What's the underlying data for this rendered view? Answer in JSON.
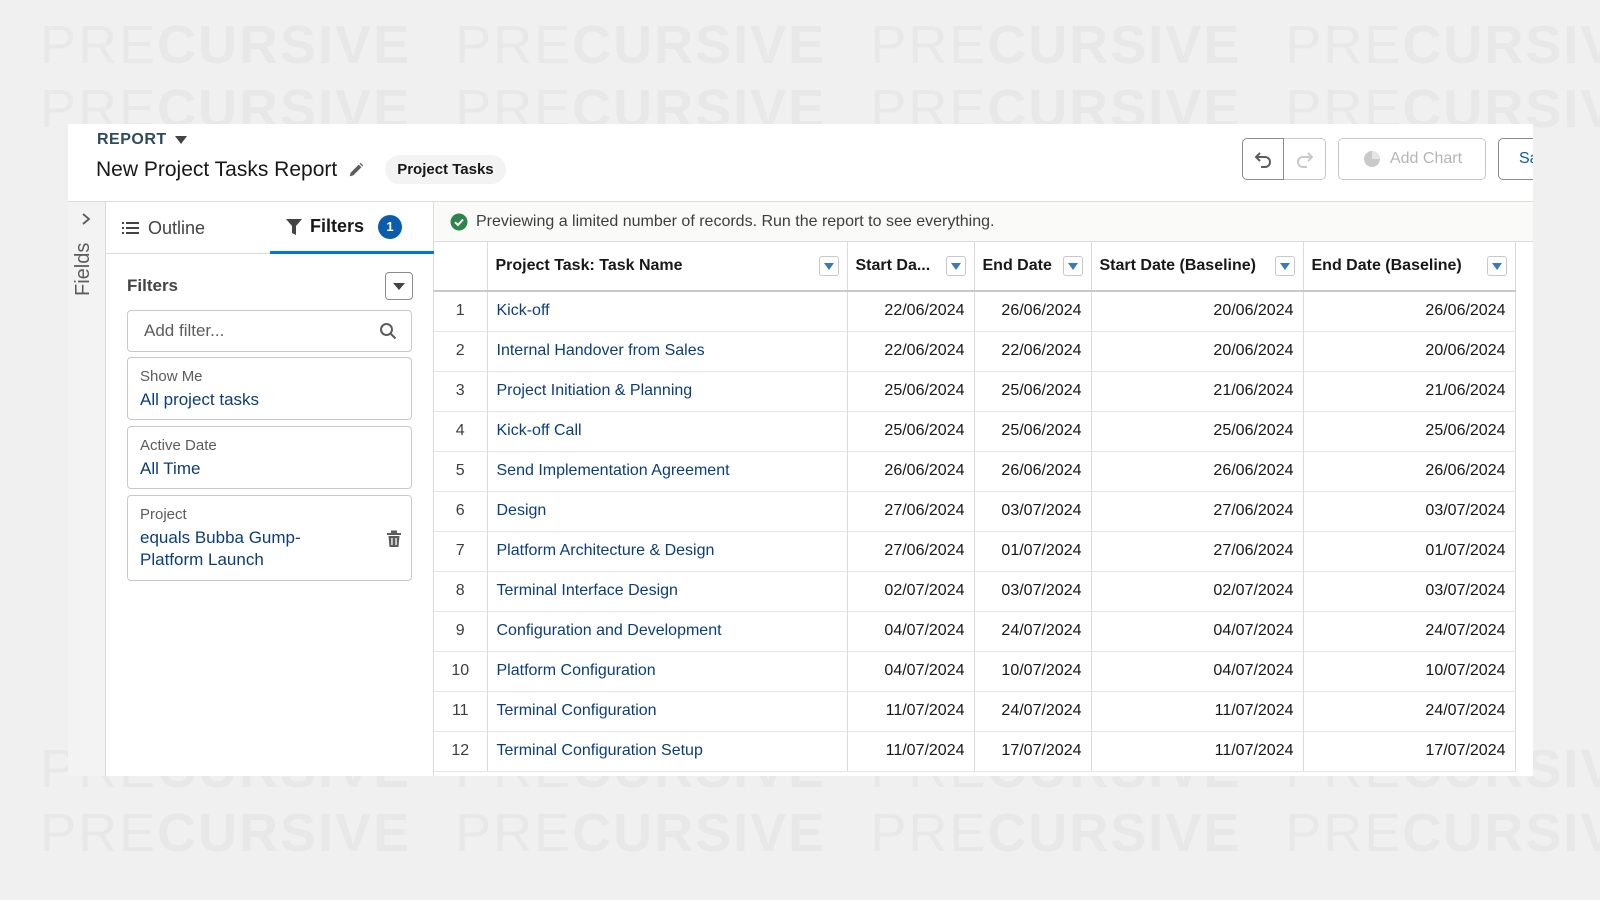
{
  "watermark": {
    "thin": "PRE",
    "bold": "CURSIVE"
  },
  "header": {
    "object_label": "REPORT",
    "title": "New Project Tasks Report",
    "report_type": "Project Tasks",
    "add_chart_label": "Add Chart",
    "save_label": "Sa"
  },
  "rail": {
    "label": "Fields"
  },
  "side": {
    "tabs": {
      "outline": "Outline",
      "filters": "Filters",
      "filters_count": "1"
    },
    "filters_heading": "Filters",
    "add_filter_placeholder": "Add filter...",
    "filter_cards": [
      {
        "label": "Show Me",
        "value": "All project tasks"
      },
      {
        "label": "Active Date",
        "value": "All Time"
      },
      {
        "label": "Project",
        "value": "equals Bubba Gump-Platform Launch"
      }
    ]
  },
  "preview_message": "Previewing a limited number of records. Run the report to see everything.",
  "table": {
    "columns": [
      "Project Task: Task Name",
      "Start Da...",
      "End Date",
      "Start Date (Baseline)",
      "End Date (Baseline)"
    ],
    "rows": [
      {
        "n": "1",
        "name": "Kick-off",
        "start": "22/06/2024",
        "end": "26/06/2024",
        "bstart": "20/06/2024",
        "bend": "26/06/2024"
      },
      {
        "n": "2",
        "name": "Internal Handover from Sales",
        "start": "22/06/2024",
        "end": "22/06/2024",
        "bstart": "20/06/2024",
        "bend": "20/06/2024"
      },
      {
        "n": "3",
        "name": "Project Initiation & Planning",
        "start": "25/06/2024",
        "end": "25/06/2024",
        "bstart": "21/06/2024",
        "bend": "21/06/2024"
      },
      {
        "n": "4",
        "name": "Kick-off Call",
        "start": "25/06/2024",
        "end": "25/06/2024",
        "bstart": "25/06/2024",
        "bend": "25/06/2024"
      },
      {
        "n": "5",
        "name": "Send Implementation Agreement",
        "start": "26/06/2024",
        "end": "26/06/2024",
        "bstart": "26/06/2024",
        "bend": "26/06/2024"
      },
      {
        "n": "6",
        "name": "Design",
        "start": "27/06/2024",
        "end": "03/07/2024",
        "bstart": "27/06/2024",
        "bend": "03/07/2024"
      },
      {
        "n": "7",
        "name": "Platform Architecture & Design",
        "start": "27/06/2024",
        "end": "01/07/2024",
        "bstart": "27/06/2024",
        "bend": "01/07/2024"
      },
      {
        "n": "8",
        "name": "Terminal Interface Design",
        "start": "02/07/2024",
        "end": "03/07/2024",
        "bstart": "02/07/2024",
        "bend": "03/07/2024"
      },
      {
        "n": "9",
        "name": "Configuration and Development",
        "start": "04/07/2024",
        "end": "24/07/2024",
        "bstart": "04/07/2024",
        "bend": "24/07/2024"
      },
      {
        "n": "10",
        "name": "Platform Configuration",
        "start": "04/07/2024",
        "end": "10/07/2024",
        "bstart": "04/07/2024",
        "bend": "10/07/2024"
      },
      {
        "n": "11",
        "name": "Terminal Configuration",
        "start": "11/07/2024",
        "end": "24/07/2024",
        "bstart": "11/07/2024",
        "bend": "24/07/2024"
      },
      {
        "n": "12",
        "name": "Terminal Configuration Setup",
        "start": "11/07/2024",
        "end": "17/07/2024",
        "bstart": "11/07/2024",
        "bend": "17/07/2024"
      }
    ]
  },
  "colors": {
    "accent": "#0176d3",
    "link": "#0b3e78",
    "success": "#2e844a",
    "badge": "#0b5cab"
  }
}
